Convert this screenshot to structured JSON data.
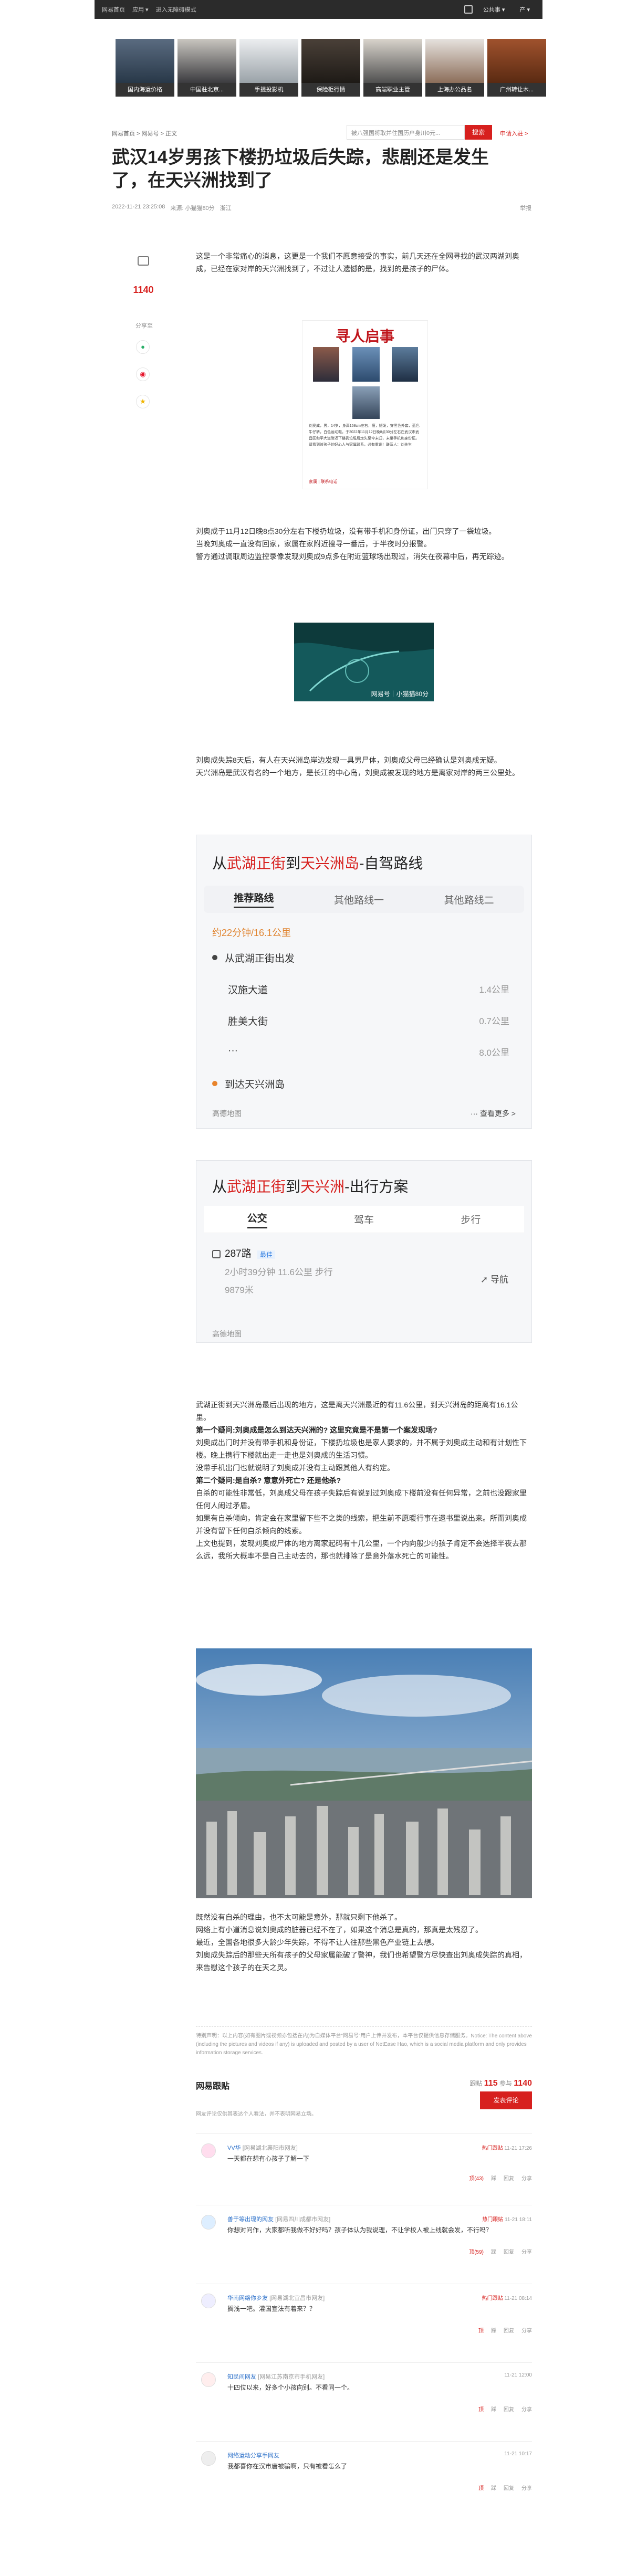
{
  "topbar": {
    "links": [
      "网易首页",
      "应用 ▾",
      "进入无障碍模式"
    ],
    "right_sel": "公共事 ▾",
    "right_link": "产 ▾"
  },
  "ads": [
    {
      "caption": "国内海运价格"
    },
    {
      "caption": "中国驻北京..."
    },
    {
      "caption": "手提投影机"
    },
    {
      "caption": "保险柜行情"
    },
    {
      "caption": "高端职业主管"
    },
    {
      "caption": "上海办公品名"
    },
    {
      "caption": "广州转让木..."
    }
  ],
  "crumb": "网易首页 > 网易号 > 正文",
  "search": {
    "placeholder": "被八强国将取并住国历户身川0元...",
    "button": "搜索",
    "link": "申请入驻 >"
  },
  "article": {
    "title": "武汉14岁男孩下楼扔垃圾后失踪，悲剧还是发生了，在天兴洲找到了",
    "meta": [
      "2022-11-21 23:25:08",
      "来源: 小猫猫80分",
      "浙江"
    ],
    "report": "举报",
    "p1": "这是一个非常痛心的消息，这更是一个我们不愿意接受的事实，前几天还在全网寻找的武汉两湖刘奥成，已经在家对岸的天兴洲找到了，不过让人遗憾的是，找到的是孩子的尸体。",
    "poster_title": "寻人启事",
    "poster_text": "刘奥成，男，14岁，身高158cm左右，瘦，短发，穿黑色外套，蓝色牛仔裤，白色运动鞋。于2022年11月12日晚8点30分左右在武汉市武昌区和平大道附近下楼扔垃圾后走失至今未归，未带手机和身份证。请看到该孩子的好心人与家属联系，必有重谢！联系人：刘先生",
    "poster_footer": "家属 | 联系电话",
    "p2": [
      "刘奥成于11月12日晚8点30分左右下楼扔垃圾，没有带手机和身份证，出门只穿了一袋垃圾。",
      "当晚刘奥成一直没有回家，家属在家附近搜寻一番后，于半夜时分报警。",
      "警方通过调取周边监控录像发现刘奥成9点多在附近篮球场出现过，消失在夜幕中后，再无踪迹。"
    ],
    "video_wm": "网易号｜小猫猫80分",
    "p3": [
      "刘奥成失踪8天后，有人在天兴洲岛岸边发现一具男尸体，刘奥成父母已经确认是刘奥成无疑。",
      "天兴洲岛是武汉有名的一个地方，是长江的中心岛，刘奥成被发现的地方是离家对岸的两三公里处。"
    ],
    "p4": [
      "武湖正街到天兴洲岛最后出现的地方，这是离天兴洲最近的有11.6公里，到天兴洲岛的距离有16.1公里。"
    ],
    "q1": "第一个疑问:刘奥成是怎么到达天兴洲的? 这里究竟是不是第一个案发现场?",
    "q1_text": [
      "刘奥成出门时并没有带手机和身份证，下楼扔垃圾也是家人要求的，并不属于刘奥成主动和有计划性下楼。晚上携行下楼就出走一走也是刘奥成的生活习惯。",
      "没带手机出门也就说明了刘奥成并没有主动跟其他人有约定。"
    ],
    "q2": "第二个疑问:是自杀? 意意外死亡? 还是他杀?",
    "q2_text": [
      "自杀的可能性非常低，刘奥成父母在孩子失踪后有说到过刘奥成下楼前没有任何异常，之前也没跟家里任何人闹过矛盾。",
      "如果有自杀倾向，肯定会在家里留下些不之类的线索，把生前不愿暖行事在遗书里说出来。所而刘奥成并没有留下任何自杀倾向的线索。",
      "上文也提到，发现刘奥成尸体的地方离家起码有十几公里，一个内向般少的孩子肯定不会选择半夜去那么远，我所大概率不是自己主动去的，那也就排除了是意外落水死亡的可能性。"
    ],
    "p5": [
      "既然没有自杀的理由，也不太可能是意外，那就只剩下他杀了。",
      "网络上有小道消息说刘奥成的脏器已经不在了，如果这个消息是真的，那真是太残忍了。",
      "最近，全国各地很多大龄少年失踪，不得不让人往那些黑色产业链上去想。",
      "刘奥成失踪后的那些天所有孩子的父母家属能破了警神，我们也希望警方尽快查出刘奥成失踪的真相，来告慰这个孩子的在天之灵。"
    ]
  },
  "side": {
    "comments": "1140",
    "share_label": "分享至"
  },
  "map1": {
    "title_a": "从",
    "title_from": "武湖正街",
    "title_b": "到",
    "title_to": "天兴洲岛",
    "title_c": "-自驾路线",
    "tabs": [
      "推荐路线",
      "其他路线一",
      "其他路线二"
    ],
    "summary": "约22分钟/16.1公里",
    "start": "从武湖正街出发",
    "rows": [
      {
        "name": "汉施大道",
        "dist": "1.4公里"
      },
      {
        "name": "胜美大街",
        "dist": "0.7公里"
      },
      {
        "name": "···",
        "dist": "8.0公里"
      }
    ],
    "end": "到达天兴洲岛",
    "source": "高德地图",
    "more": "···  查看更多 >"
  },
  "map2": {
    "title_a": "从",
    "title_from": "武湖正街",
    "title_b": "到",
    "title_to": "天兴洲",
    "title_c": "-出行方案",
    "tabs": [
      "公交",
      "驾车",
      "步行"
    ],
    "bus": "287路",
    "badge": "最佳",
    "line1": "2小时39分钟   11.6公里   步行",
    "line2": "9879米",
    "nav": "导航",
    "source": "高德地图"
  },
  "disclaimer": "特别声明：以上内容(如有图片或视频亦包括在内)为自媒体平台“网易号”用户上传并发布，本平台仅提供信息存储服务。Notice: The content above (including the pictures and videos if any) is uploaded and posted by a user of NetEase Hao, which is a social media platform and only provides information storage services.",
  "comments": {
    "title": "网易跟贴",
    "count_label": "跟贴 ",
    "count": "115",
    "join_label": "参与 ",
    "join": "1140",
    "tip": "网友评论仅供其表达个人看法，并不表明网易立场。",
    "post": "发表评论",
    "items": [
      {
        "user": "VV华",
        "loc": "[网易湖北襄阳市网友]",
        "hot": "热门跟贴",
        "time": "11-21 17:26",
        "text": "一天都在想有心孩子了解一下",
        "acts": [
          "顶(43)",
          "踩",
          "回复",
          "分享"
        ]
      },
      {
        "user": "善于等出现的网友",
        "loc": "[网易四川成都市网友]",
        "hot": "热门跟贴",
        "time": "11-21 18:11",
        "text": "你想对问作，大家都听我做不好好吗？孩子体认为我说理，不让学校人被上线就会发，不行吗？",
        "acts": [
          "顶(59)",
          "踩",
          "回复",
          "分享"
        ]
      },
      {
        "user": "华南网络你乡友",
        "loc": "[网易湖北宜昌市网友]",
        "hot": "热门跟贴",
        "time": "11-21 08:14",
        "text": "搁浅一吧。灌国宣法有着来？？",
        "acts": [
          "顶",
          "踩",
          "回复",
          "分享"
        ]
      },
      {
        "user": "知民间网友",
        "loc": "[网易江苏南京市手机网友]",
        "hot": "",
        "time": "11-21 12:00",
        "text": "十四位以来，好多个小孩向别。不看同一个。",
        "acts": [
          "顶",
          "踩",
          "回复",
          "分享"
        ]
      },
      {
        "user": "网络运动分享手网友",
        "loc": "",
        "hot": "",
        "time": "11-21 10:17",
        "text": "我都喜你在汉市唐被骗啊，只有被看怎么了",
        "acts": [
          "顶",
          "踩",
          "回复",
          "分享"
        ]
      }
    ]
  }
}
